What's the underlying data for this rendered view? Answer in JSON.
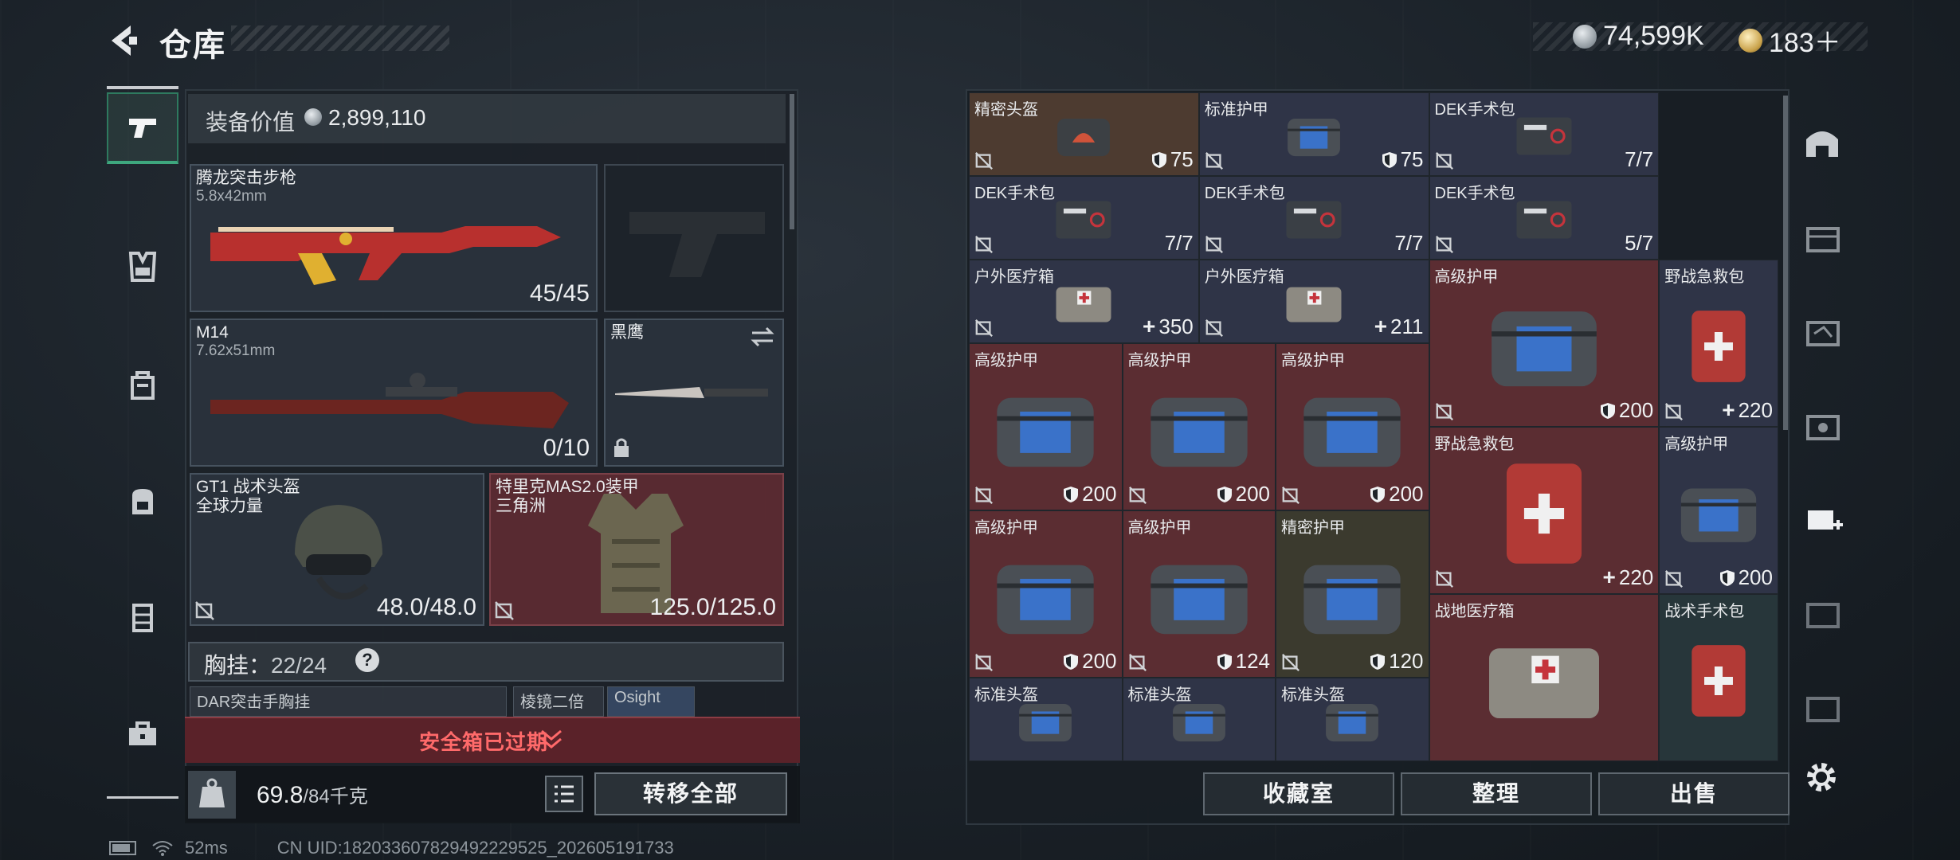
{
  "header": {
    "title": "仓库",
    "currency_silver": "74,599K",
    "currency_gold": "183＋"
  },
  "loadout": {
    "value_label": "装备价值",
    "value": "2,899,110",
    "primary": {
      "name": "腾龙突击步枪",
      "caliber": "5.8x42mm",
      "ammo": "45/45"
    },
    "secondary": {
      "name": "M14",
      "caliber": "7.62x51mm",
      "ammo": "0/10"
    },
    "melee": {
      "name": "黑鹰"
    },
    "helmet": {
      "name": "GT1 战术头盔",
      "sub": "全球力量",
      "durability": "48.0/48.0"
    },
    "armor": {
      "name": "特里克MAS2.0装甲",
      "sub": "三角洲",
      "durability": "125.0/125.0"
    },
    "chest_rig": {
      "label": "胸挂：",
      "capacity": "22/24",
      "help": "?"
    },
    "chest_slots": [
      "DAR突击手胸挂",
      "棱镜二倍",
      "Osight"
    ],
    "safe_box": "安全箱已过期",
    "weight": "69.8",
    "weight_max": "/84千克",
    "transfer_all": "转移全部"
  },
  "grid": {
    "items": [
      {
        "name": "精密头盔",
        "value": "75",
        "kind": "shield"
      },
      {
        "name": "标准护甲",
        "value": "75",
        "kind": "shield"
      },
      {
        "name": "DEK手术包",
        "value": "7/7",
        "kind": "count"
      },
      {
        "name": "DEK手术包",
        "value": "7/7",
        "kind": "count"
      },
      {
        "name": "DEK手术包",
        "value": "7/7",
        "kind": "count"
      },
      {
        "name": "DEK手术包",
        "value": "5/7",
        "kind": "count"
      },
      {
        "name": "户外医疗箱",
        "value": "350",
        "kind": "heal"
      },
      {
        "name": "户外医疗箱",
        "value": "211",
        "kind": "heal"
      },
      {
        "name": "高级护甲",
        "value": "200",
        "kind": "shield"
      },
      {
        "name": "野战急救包",
        "value": "220",
        "kind": "heal"
      },
      {
        "name": "高级护甲",
        "value": "200",
        "kind": "shield"
      },
      {
        "name": "高级护甲",
        "value": "200",
        "kind": "shield"
      },
      {
        "name": "高级护甲",
        "value": "200",
        "kind": "shield"
      },
      {
        "name": "高级护甲",
        "value": "200",
        "kind": "shield"
      },
      {
        "name": "野战急救包",
        "value": "220",
        "kind": "heal"
      },
      {
        "name": "高级护甲",
        "value": "200",
        "kind": "shield"
      },
      {
        "name": "高级护甲",
        "value": "124",
        "kind": "shield"
      },
      {
        "name": "精密护甲",
        "value": "120",
        "kind": "shield"
      },
      {
        "name": "战地医疗箱",
        "value": "",
        "kind": "none"
      },
      {
        "name": "战术手术包",
        "value": "",
        "kind": "none"
      },
      {
        "name": "标准头盔",
        "value": "",
        "kind": "none"
      },
      {
        "name": "标准头盔",
        "value": "",
        "kind": "none"
      },
      {
        "name": "标准头盔",
        "value": "",
        "kind": "none"
      }
    ],
    "buttons": {
      "collection": "收藏室",
      "sort": "整理",
      "sell": "出售"
    }
  },
  "footer": {
    "ping": "52ms",
    "uid": "CN UID:182033607829492229525_202605191733"
  },
  "colors": {
    "accent_green": "#3ea77e",
    "warning_red": "#ff6a6a"
  }
}
